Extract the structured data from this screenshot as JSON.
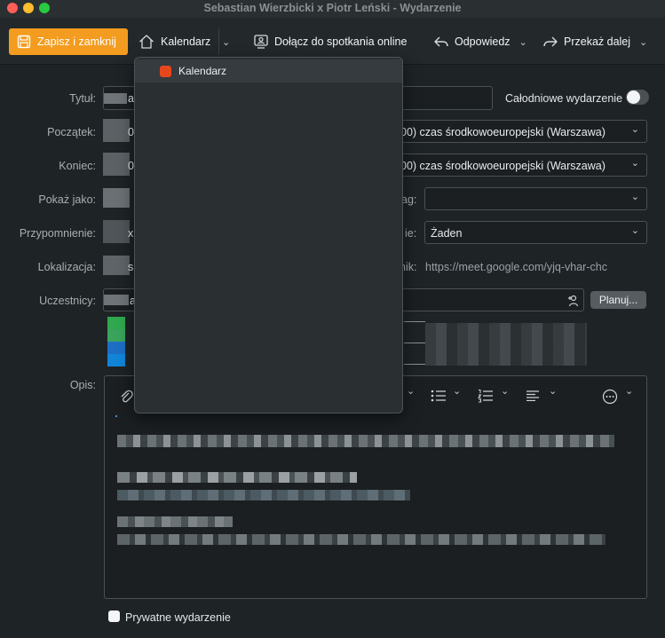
{
  "window": {
    "title": "Sebastian Wierzbicki x Piotr Leński - Wydarzenie"
  },
  "toolbar": {
    "save_label": "Zapisz i zamknij",
    "calendar_label": "Kalendarz",
    "join_online_label": "Dołącz do spotkania online",
    "reply_label": "Odpowiedz",
    "forward_label": "Przekaż dalej"
  },
  "calendar_menu": {
    "items": [
      {
        "label": "Kalendarz",
        "color": "#e8471c"
      }
    ]
  },
  "form": {
    "title_label": "Tytuł:",
    "title_value": "a",
    "all_day_label": "Całodniowe wydarzenie",
    "all_day_on": false,
    "start_label": "Początek:",
    "start_value_fragment": "0",
    "start_timezone": "00) czas środkowoeuropejski (Warszawa)",
    "end_label": "Koniec:",
    "end_value_fragment": "0",
    "end_timezone": "00) czas środkowoeuropejski (Warszawa)",
    "show_as_label": "Pokaż jako:",
    "tag_label_fragment": "ag:",
    "tag_value": "",
    "reminder_label": "Przypomnienie:",
    "reminder_value_fragment": "x",
    "repeat_label_fragment": "ie:",
    "repeat_value": "Żaden",
    "location_label": "Lokalizacja:",
    "location_value_fragment": "s",
    "link_label_fragment": "nik:",
    "link_value": "https://meet.google.com/yjq-vhar-chc",
    "attendees_label": "Uczestnicy:",
    "attendees_value_fragment": "a",
    "schedule_label": "Planuj...",
    "description_label": "Opis:",
    "description_lines": [
      "                                                                ",
      "                                                       ",
      "                                                            ",
      "                                   ",
      "                                                                                     "
    ],
    "private_label": "Prywatne wydarzenie",
    "private_checked": false
  },
  "icons": {
    "save": "save-icon",
    "calendar": "home-icon",
    "join": "video-meeting-icon",
    "reply": "reply-icon",
    "forward": "forward-icon"
  }
}
